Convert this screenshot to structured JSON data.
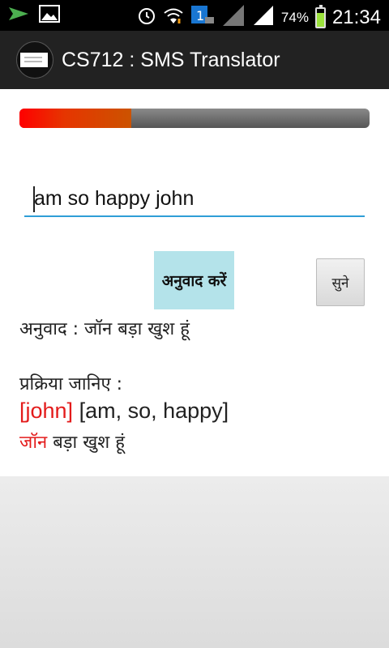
{
  "status_bar": {
    "battery_percent": "74%",
    "battery_level": 0.74,
    "time": "21:34",
    "icons": [
      "notification-send-icon",
      "gallery-icon",
      "alarm-icon",
      "wifi-icon",
      "notification-badge-icon",
      "no-signal-icon",
      "signal-icon",
      "battery-icon"
    ]
  },
  "action_bar": {
    "title": "CS712 : SMS Translator"
  },
  "progress": {
    "value": 0.32
  },
  "input": {
    "value": "am so happy john"
  },
  "buttons": {
    "translate": "अनुवाद करें",
    "listen": "सुने"
  },
  "result": {
    "text": "अनुवाद : जॉन बड़ा खुश हूं"
  },
  "process": {
    "heading": "प्रक्रिया जानिए :",
    "line1_bracket": "[john]",
    "line1_rest": " [am, so, happy]",
    "line2_highlight": "जॉन",
    "line2_rest": " बड़ा खुश हूं"
  },
  "colors": {
    "accent": "#2f9ed7",
    "button_bg": "#b4e3ea",
    "highlight": "#e31b1b"
  }
}
